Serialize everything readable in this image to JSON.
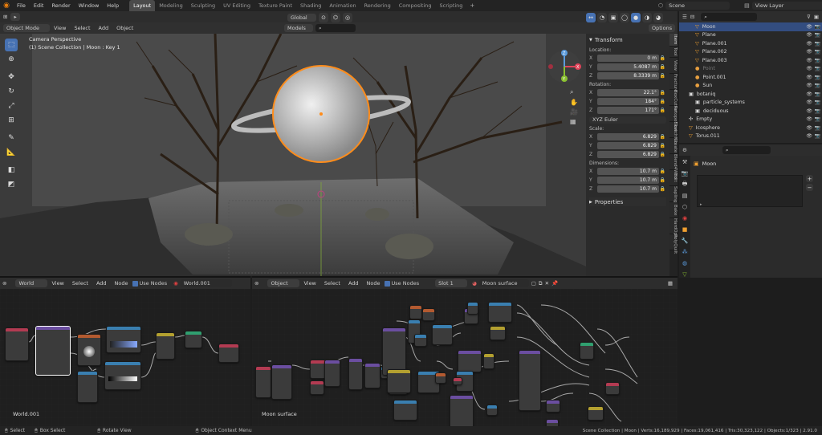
{
  "topbar": {
    "menus": [
      "File",
      "Edit",
      "Render",
      "Window",
      "Help"
    ],
    "workspaces": [
      "Layout",
      "Modeling",
      "Sculpting",
      "UV Editing",
      "Texture Paint",
      "Shading",
      "Animation",
      "Rendering",
      "Compositing",
      "Scripting"
    ],
    "active_workspace": "Layout",
    "scene": "Scene",
    "view_layer": "View Layer"
  },
  "viewport": {
    "mode": "Object Mode",
    "menus": [
      "View",
      "Select",
      "Add",
      "Object"
    ],
    "orientation": "Global",
    "options": "Options",
    "overlay_title": "Camera Perspective",
    "overlay_sub": "(1) Scene Collection | Moon : Key 1",
    "collection_filter": "Models",
    "gizmo_axes": [
      "X",
      "Y",
      "Z"
    ]
  },
  "npanel": {
    "transform_title": "Transform",
    "location_label": "Location:",
    "location": [
      {
        "axis": "X",
        "value": "0 m"
      },
      {
        "axis": "Y",
        "value": "5.4087 m"
      },
      {
        "axis": "Z",
        "value": "8.3339 m"
      }
    ],
    "rotation_label": "Rotation:",
    "rotation": [
      {
        "axis": "X",
        "value": "22.1°"
      },
      {
        "axis": "Y",
        "value": "184°"
      },
      {
        "axis": "Z",
        "value": "171°"
      }
    ],
    "euler": "XYZ Euler",
    "scale_label": "Scale:",
    "scale": [
      {
        "axis": "X",
        "value": "6.829"
      },
      {
        "axis": "Y",
        "value": "6.829"
      },
      {
        "axis": "Z",
        "value": "6.829"
      }
    ],
    "dimensions_label": "Dimensions:",
    "dimensions": [
      {
        "axis": "X",
        "value": "10.7 m"
      },
      {
        "axis": "Y",
        "value": "10.7 m"
      },
      {
        "axis": "Z",
        "value": "10.7 m"
      }
    ],
    "properties_title": "Properties",
    "tabs": [
      "Item",
      "Tool",
      "View",
      "Fracture",
      "BoxCutter",
      "RetopoFlow",
      "Sketchfab",
      "Create",
      "Blend4Web",
      "Edit",
      "Sapling",
      "Bake",
      "HardOps",
      "PolyQuilt"
    ]
  },
  "outliner": {
    "rows": [
      {
        "name": "Moon",
        "indent": 2,
        "selected": true,
        "icon": "▽"
      },
      {
        "name": "Plane",
        "indent": 2,
        "icon": "▽"
      },
      {
        "name": "Plane.001",
        "indent": 2,
        "icon": "▽"
      },
      {
        "name": "Plane.002",
        "indent": 2,
        "icon": "▽"
      },
      {
        "name": "Plane.003",
        "indent": 2,
        "icon": "▽"
      },
      {
        "name": "Point",
        "indent": 2,
        "icon": "●",
        "dim": true
      },
      {
        "name": "Point.001",
        "indent": 2,
        "icon": "●"
      },
      {
        "name": "Sun",
        "indent": 2,
        "icon": "●"
      },
      {
        "name": "botaniq",
        "indent": 1,
        "icon": "▣"
      },
      {
        "name": "particle_systems",
        "indent": 2,
        "icon": "▣"
      },
      {
        "name": "deciduous",
        "indent": 2,
        "icon": "▣"
      },
      {
        "name": "Empty",
        "indent": 1,
        "icon": "✣"
      },
      {
        "name": "Icosphere",
        "indent": 1,
        "icon": "▽"
      },
      {
        "name": "Torus.011",
        "indent": 1,
        "icon": "▽"
      }
    ]
  },
  "properties": {
    "object_name": "Moon"
  },
  "world_editor": {
    "type": "World",
    "menus": [
      "View",
      "Select",
      "Add",
      "Node"
    ],
    "use_nodes": "Use Nodes",
    "datablock": "World.001",
    "label": "World.001"
  },
  "shader_editor": {
    "type": "Object",
    "menus": [
      "View",
      "Select",
      "Add",
      "Node"
    ],
    "use_nodes": "Use Nodes",
    "slot": "Slot 1",
    "material": "Moon surface",
    "label": "Moon surface"
  },
  "statusbar": {
    "select": "Select",
    "box_select": "Box Select",
    "rotate": "Rotate View",
    "context": "Object Context Menu",
    "stats": "Scene Collection | Moon | Verts:16,189,929 | Faces:19,061,416 | Tris:30,323,122 | Objects:1/323 | 2.91.0"
  },
  "colors": {
    "accent": "#4772b3",
    "selection": "#ff8c1a"
  }
}
